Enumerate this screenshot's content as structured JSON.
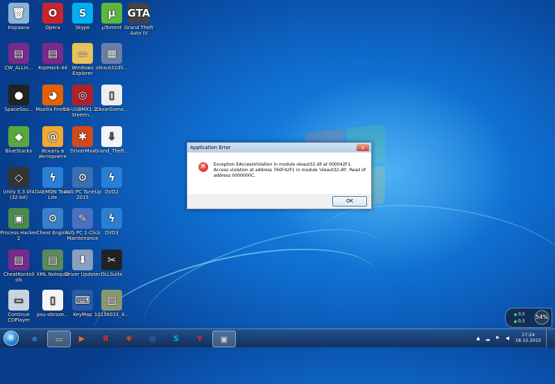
{
  "desktop": {
    "icons": [
      {
        "label": "Корзина",
        "glyph": "🗑",
        "color": "#8ab4d6",
        "icon": "recycle-bin-icon"
      },
      {
        "label": "Opera",
        "glyph": "O",
        "color": "#c9252c",
        "icon": "opera-icon"
      },
      {
        "label": "Skype",
        "glyph": "S",
        "color": "#00aff0",
        "icon": "skype-icon"
      },
      {
        "label": "µTorrent",
        "glyph": "µ",
        "color": "#5cb83c",
        "icon": "utorrent-icon"
      },
      {
        "label": "Grand Theft Auto IV",
        "glyph": "GTA",
        "color": "#444",
        "icon": "gta-iv-icon"
      },
      {
        "label": "CW_ALLin...",
        "glyph": "▤",
        "color": "#7a2a8c",
        "icon": "winrar-archive-icon"
      },
      {
        "label": "KopHack-44",
        "glyph": "▤",
        "color": "#7a2a8c",
        "icon": "winrar-archive-icon"
      },
      {
        "label": "Windows Explorer",
        "glyph": "▭",
        "color": "#e8c25a",
        "icon": "folder-icon"
      },
      {
        "label": "oleaut32dll...",
        "glyph": "▦",
        "color": "#6a7fa8",
        "icon": "file-icon"
      },
      {
        "label": "SpaceSou...",
        "glyph": "●",
        "color": "#222",
        "icon": "space-sound-icon"
      },
      {
        "label": "Mozilla Firefox",
        "glyph": "◕",
        "color": "#e66000",
        "icon": "firefox-icon"
      },
      {
        "label": "LS-USBMX1 2.3 Steerin...",
        "glyph": "◎",
        "color": "#b0212b",
        "icon": "steering-wheel-icon"
      },
      {
        "label": "ZaxarGame...",
        "glyph": "▯",
        "color": "#eeeeee",
        "icon": "document-icon"
      },
      {
        "label": "BlueStacks",
        "glyph": "◆",
        "color": "#5aa83c",
        "icon": "bluestacks-icon"
      },
      {
        "label": "Искать в Интернете",
        "glyph": "@",
        "color": "#f0a830",
        "icon": "search-web-icon"
      },
      {
        "label": "DriverMax",
        "glyph": "✱",
        "color": "#d04a1a",
        "icon": "drivermax-icon"
      },
      {
        "label": "Grand_Theft...",
        "glyph": "⇩",
        "color": "#f4f4f4",
        "icon": "torrent-file-icon"
      },
      {
        "label": "Unity 5.3.0f4 (32-bit)",
        "glyph": "◇",
        "color": "#333",
        "icon": "unity-icon"
      },
      {
        "label": "DAEMON Tools Lite",
        "glyph": "ϟ",
        "color": "#2a7fd4",
        "icon": "daemon-tools-icon"
      },
      {
        "label": "AVG PC TuneUp 2015",
        "glyph": "⚙",
        "color": "#3a6fb0",
        "icon": "avg-tuneup-icon"
      },
      {
        "label": "DVD2",
        "glyph": "ϟ",
        "color": "#2a7fd4",
        "icon": "daemon-disc-icon"
      },
      {
        "label": "Process Hacker 2",
        "glyph": "▣",
        "color": "#4a8a4a",
        "icon": "process-hacker-icon"
      },
      {
        "label": "Cheat Engine",
        "glyph": "⚙",
        "color": "#3a7fc8",
        "icon": "cheat-engine-icon"
      },
      {
        "label": "AVG PC 1-Click Maintenance",
        "glyph": "✎",
        "color": "#4a70c0",
        "icon": "avg-maintenance-icon"
      },
      {
        "label": "DVD3",
        "glyph": "ϟ",
        "color": "#2a7fd4",
        "icon": "daemon-disc-icon"
      },
      {
        "label": "CheatKontoll ols",
        "glyph": "▤",
        "color": "#7a2a8c",
        "icon": "winrar-archive-icon"
      },
      {
        "label": "XML Notepad",
        "glyph": "▤",
        "color": "#5a8a5a",
        "icon": "xml-notepad-icon"
      },
      {
        "label": "Driver Updater",
        "glyph": "⬇",
        "color": "#8aa0c0",
        "icon": "driver-updater-icon"
      },
      {
        "label": "DLLSuite",
        "glyph": "✂",
        "color": "#222",
        "icon": "dllsuite-icon"
      },
      {
        "label": "Continue CDPlayer",
        "glyph": "▭",
        "color": "#c8d4e0",
        "icon": "cdplayer-icon"
      },
      {
        "label": "psu-obraze...",
        "glyph": "▯",
        "color": "#f4f4f4",
        "icon": "document-icon"
      },
      {
        "label": "KeyMap",
        "glyph": "⌨",
        "color": "#2a5aa8",
        "icon": "keymap-icon"
      },
      {
        "label": "10156031_4...",
        "glyph": "▨",
        "color": "#8a9870",
        "icon": "image-file-icon"
      }
    ]
  },
  "dialog": {
    "title": "Application Error",
    "close": "x",
    "message_line1": "Exception EAccessViolation in module oleaut32.dll at 000042F1.",
    "message_line2": "Access violation at address 760F42F1 in module 'oleaut32.dll'. Read of",
    "message_line3": "address 0000000C.",
    "ok_label": "OK"
  },
  "gadget": {
    "cpu": "0,5",
    "ram": "0,3",
    "percent": "54%"
  },
  "taskbar": {
    "apps": [
      {
        "glyph": "e",
        "color": "#2a8ad8",
        "icon": "ie-icon"
      },
      {
        "glyph": "▭",
        "color": "#e8c25a",
        "icon": "explorer-icon"
      },
      {
        "glyph": "▶",
        "color": "#e86a1a",
        "icon": "media-player-icon"
      },
      {
        "glyph": "Я",
        "color": "#e8231a",
        "icon": "yandex-icon"
      },
      {
        "glyph": "✱",
        "color": "#d04a1a",
        "icon": "drivermax-icon"
      },
      {
        "glyph": "◎",
        "color": "#3a7fc8",
        "icon": "avg-icon"
      },
      {
        "glyph": "S",
        "color": "#00aff0",
        "icon": "skype-icon"
      },
      {
        "glyph": "Y",
        "color": "#e8231a",
        "icon": "yandex-browser-icon"
      },
      {
        "glyph": "▣",
        "color": "#d8d8d8",
        "icon": "application-window-icon"
      }
    ],
    "time": "17:24",
    "date": "18.12.2015"
  }
}
